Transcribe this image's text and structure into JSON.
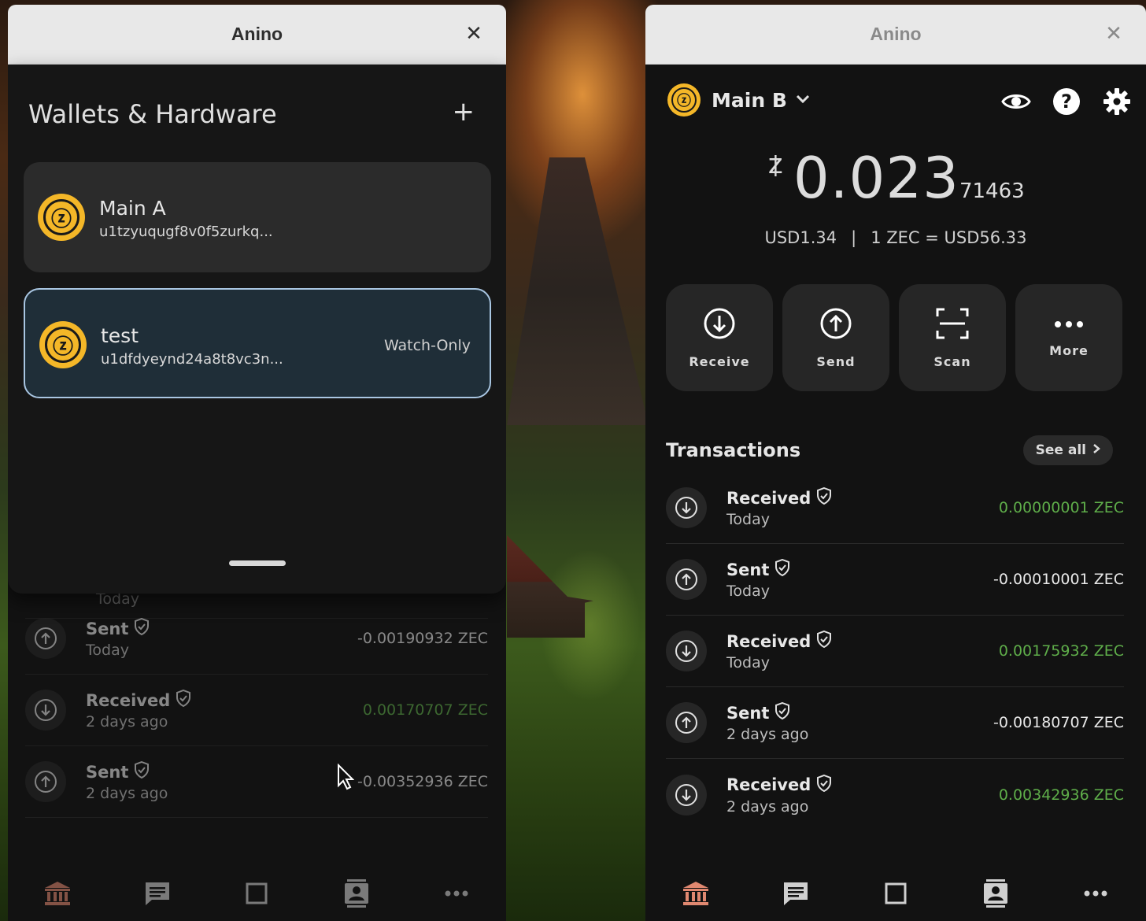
{
  "colors": {
    "accent_zec": "#f4b728",
    "selected_border": "#a9c6e2",
    "received_green": "#5fae4a",
    "panel_bg": "#121212"
  },
  "left_window": {
    "title": "Anino",
    "close_icon": "close-icon",
    "sheet": {
      "title": "Wallets & Hardware",
      "add_icon": "plus-icon",
      "add_label": "+",
      "wallets": [
        {
          "name": "Main A",
          "address": "u1tzyuqugf8v0f5zurkq...",
          "badge": "",
          "selected": false
        },
        {
          "name": "test",
          "address": "u1dfdyeynd24a8t8vc3n...",
          "badge": "Watch-Only",
          "selected": true
        }
      ]
    },
    "partial_row_date": "Today",
    "transactions": [
      {
        "type": "Sent",
        "date": "Today",
        "amount": "-0.00190932 ZEC",
        "direction": "out"
      },
      {
        "type": "Received",
        "date": "2 days ago",
        "amount": "0.00170707 ZEC",
        "direction": "in"
      },
      {
        "type": "Sent",
        "date": "2 days ago",
        "amount": "-0.00352936 ZEC",
        "direction": "out"
      }
    ]
  },
  "right_window": {
    "title": "Anino",
    "account": {
      "name": "Main B",
      "icon": "chevron-down-icon"
    },
    "top_icons": [
      "eye-icon",
      "help-icon",
      "gear-icon"
    ],
    "balance": {
      "symbol": "ᙇ",
      "main": "0.023",
      "fraction": "71463",
      "fiat": "USD1.34",
      "separator": "|",
      "rate": "1 ZEC = USD56.33"
    },
    "actions": [
      {
        "label": "Receive",
        "icon": "receive-icon"
      },
      {
        "label": "Send",
        "icon": "send-icon"
      },
      {
        "label": "Scan",
        "icon": "scan-icon"
      },
      {
        "label": "More",
        "icon": "more-icon"
      }
    ],
    "transactions_header": "Transactions",
    "see_all": "See all",
    "transactions": [
      {
        "type": "Received",
        "date": "Today",
        "amount": "0.00000001 ZEC",
        "direction": "in"
      },
      {
        "type": "Sent",
        "date": "Today",
        "amount": "-0.00010001 ZEC",
        "direction": "out"
      },
      {
        "type": "Received",
        "date": "Today",
        "amount": "0.00175932 ZEC",
        "direction": "in"
      },
      {
        "type": "Sent",
        "date": "2 days ago",
        "amount": "-0.00180707 ZEC",
        "direction": "out"
      },
      {
        "type": "Received",
        "date": "2 days ago",
        "amount": "0.00342936 ZEC",
        "direction": "in"
      }
    ]
  },
  "bottom_nav": [
    "bank-icon",
    "chat-icon",
    "square-icon",
    "contacts-icon",
    "more-horizontal-icon"
  ]
}
